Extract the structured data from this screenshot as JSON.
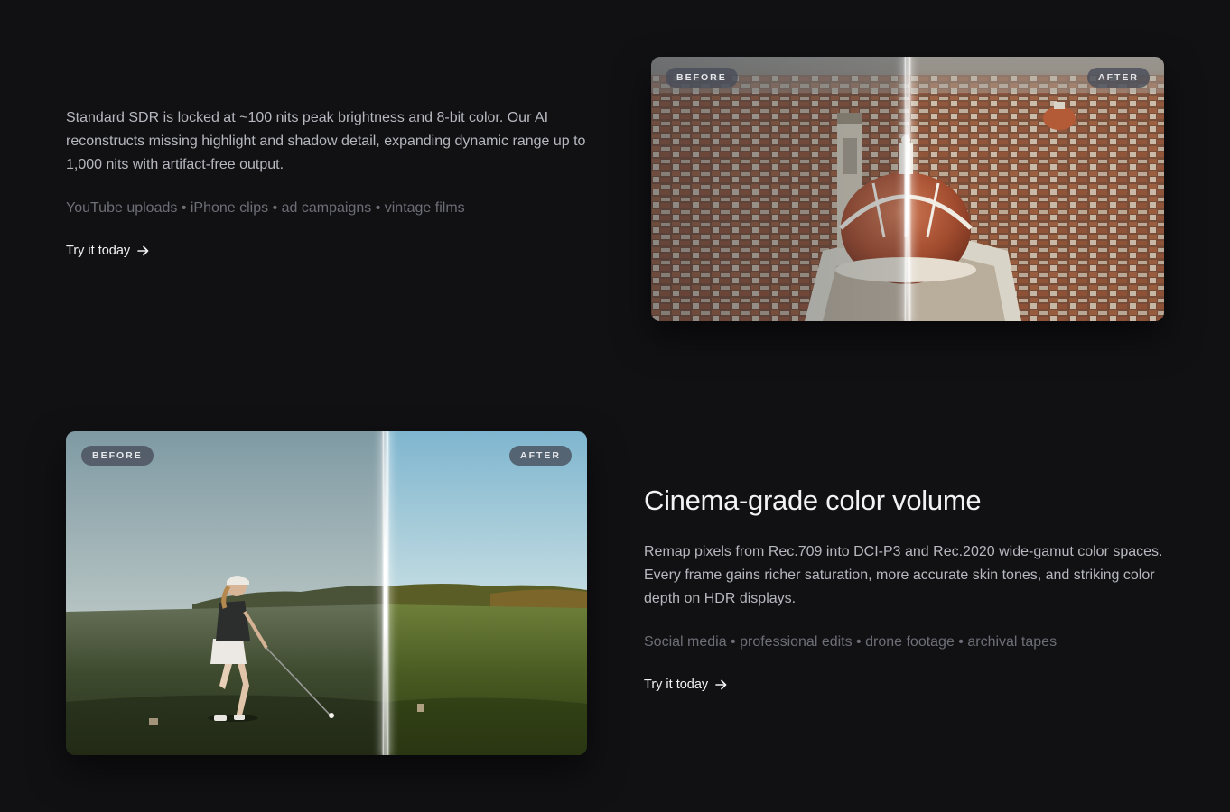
{
  "features": [
    {
      "description": "Standard SDR is locked at ~100 nits peak brightness and 8-bit color. Our AI reconstructs missing highlight and shadow detail, expanding dynamic range up to 1,000 nits with artifact-free output.",
      "tags": "YouTube uploads • iPhone clips • ad campaigns • vintage films",
      "cta_label": "Try it today",
      "comparison": {
        "before_label": "BEFORE",
        "after_label": "AFTER"
      }
    },
    {
      "title": "Cinema-grade color volume",
      "description": "Remap pixels from Rec.709 into DCI-P3 and Rec.2020 wide-gamut color spaces. Every frame gains richer saturation, more accurate skin tones, and striking color depth on HDR displays.",
      "tags": "Social media • professional edits • drone footage • archival tapes",
      "cta_label": "Try it today",
      "comparison": {
        "before_label": "BEFORE",
        "after_label": "AFTER"
      }
    }
  ],
  "icons": {
    "cta": "arrow-right-icon"
  },
  "colors": {
    "background": "#111114",
    "heading": "#f3f3f5",
    "body_text": "#b7b8bf",
    "muted_text": "#6d6e76",
    "badge_bg": "#464c58"
  }
}
